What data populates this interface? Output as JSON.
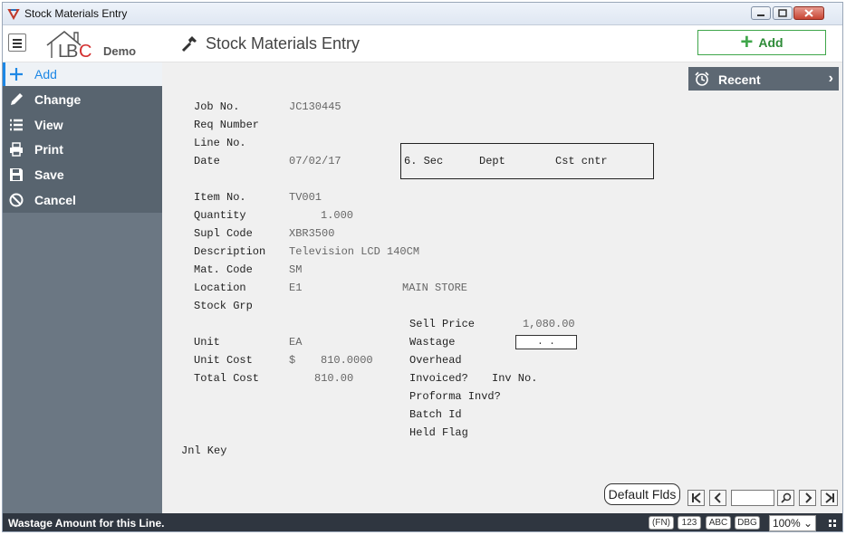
{
  "window": {
    "title": "Stock Materials Entry"
  },
  "header": {
    "demo_label": "Demo",
    "page_title": "Stock Materials Entry",
    "add_label": "Add"
  },
  "sidebar": {
    "items": [
      {
        "label": "Add",
        "icon": "plus-icon"
      },
      {
        "label": "Change",
        "icon": "pencil-icon"
      },
      {
        "label": "View",
        "icon": "list-icon"
      },
      {
        "label": "Print",
        "icon": "printer-icon"
      },
      {
        "label": "Save",
        "icon": "floppy-icon"
      },
      {
        "label": "Cancel",
        "icon": "cancel-icon"
      }
    ]
  },
  "recent": {
    "label": "Recent"
  },
  "form": {
    "job_no_label": "Job No.",
    "job_no": "JC130445",
    "req_number_label": "Req Number",
    "line_no_label": "Line No.",
    "date_label": "Date",
    "date": "07/02/17",
    "sec_label": "6. Sec",
    "dept_label": "Dept",
    "cst_cntr_label": "Cst cntr",
    "item_no_label": "Item No.",
    "item_no": "TV001",
    "quantity_label": "Quantity",
    "quantity": "1.000",
    "supl_code_label": "Supl Code",
    "supl_code": "XBR3500",
    "description_label": "Description",
    "description": "Television LCD 140CM",
    "mat_code_label": "Mat. Code",
    "mat_code": "SM",
    "location_label": "Location",
    "location": "E1",
    "location_name": "MAIN STORE",
    "stock_grp_label": "Stock Grp",
    "sell_price_label": "Sell Price",
    "sell_price": "1,080.00",
    "unit_label": "Unit",
    "unit": "EA",
    "wastage_label": "Wastage",
    "wastage": ".  .",
    "unit_cost_label": "Unit Cost",
    "unit_cost_currency": "$",
    "unit_cost": "810.0000",
    "overhead_label": "Overhead",
    "total_cost_label": "Total Cost",
    "total_cost": "810.00",
    "invoiced_label": "Invoiced?",
    "inv_no_label": "Inv No.",
    "proforma_label": "Proforma Invd?",
    "batch_id_label": "Batch Id",
    "held_flag_label": "Held Flag",
    "jnl_key_label": "Jnl Key"
  },
  "footer": {
    "default_flds_label": "Default Flds"
  },
  "status": {
    "message": "Wastage Amount for this Line.",
    "fn_label": "(FN)",
    "num_label": "123",
    "abc_label": "ABC",
    "dbg_label": "DBG",
    "zoom": "100% ⌄"
  },
  "colors": {
    "accent": "#1e88e5",
    "add_green": "#3fa64a",
    "sidebar": "#6b7783",
    "menu": "#58646f",
    "statusbar": "#2f3640"
  }
}
